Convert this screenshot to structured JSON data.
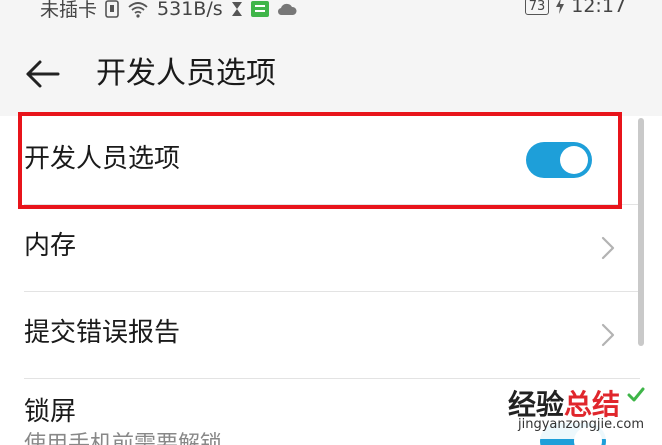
{
  "status_bar": {
    "carrier": "未插卡",
    "net_speed": "531B/s",
    "battery": "73",
    "time": "12:17"
  },
  "toolbar": {
    "title": "开发人员选项"
  },
  "settings": {
    "items": [
      {
        "label": "开发人员选项",
        "toggle_on": true
      },
      {
        "label": "内存"
      },
      {
        "label": "提交错误报告"
      },
      {
        "label": "锁屏",
        "subtitle": "使用手机前需要解锁",
        "toggle_on": true
      }
    ]
  },
  "watermark": {
    "brand_a": "经验",
    "brand_b": "总结",
    "url": "jingyanzongjie.com"
  },
  "colors": {
    "accent": "#1e9fd9",
    "highlight": "#e8141b"
  }
}
